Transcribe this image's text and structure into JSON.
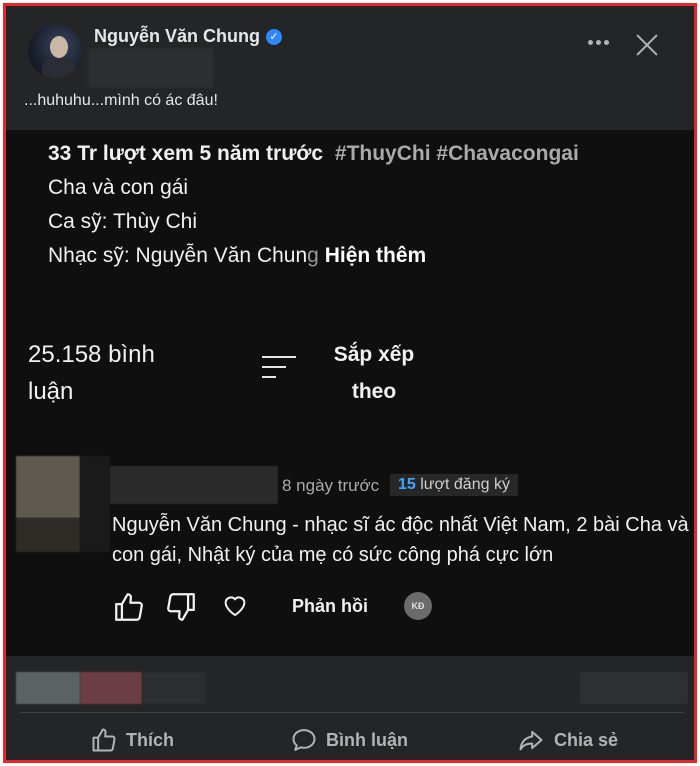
{
  "post": {
    "author": "Nguyễn Văn Chung",
    "verified_icon": "verified-check-icon",
    "caption": "...huhuhu...mình có ác đâu!"
  },
  "video": {
    "stats": "33 Tr lượt xem  5 năm trước",
    "tags": "#ThuyChi #Chavacongai",
    "desc_line1": "Cha và con gái",
    "desc_line2": "Ca sỹ: Thùy Chi",
    "desc_line3_prefix": "Nhạc sỹ: Nguyễn Văn Chun",
    "desc_line3_fade": "g",
    "show_more": "Hiện thêm",
    "comment_count": "25.158 bình luận",
    "sort_label": "Sắp xếp theo"
  },
  "comment": {
    "time": "8 ngày trước",
    "subscribers_count": "15",
    "subscribers_label": "lượt đăng ký",
    "text": "Nguyễn Văn Chung - nhạc sĩ ác độc nhất Việt Nam, 2 bài Cha và con gái, Nhật ký của mẹ có sức công phá cực lớn",
    "reply_label": "Phản hồi",
    "creator_badge": "KĐ"
  },
  "actions": {
    "like": "Thích",
    "comment": "Bình luận",
    "share": "Chia sẻ"
  },
  "colors": {
    "frame_border": "#e8252a",
    "facebook_bg": "#242526",
    "youtube_bg": "#0f0f0f",
    "verified_blue": "#2d88ff",
    "subscriber_blue": "#3ea6ff"
  }
}
